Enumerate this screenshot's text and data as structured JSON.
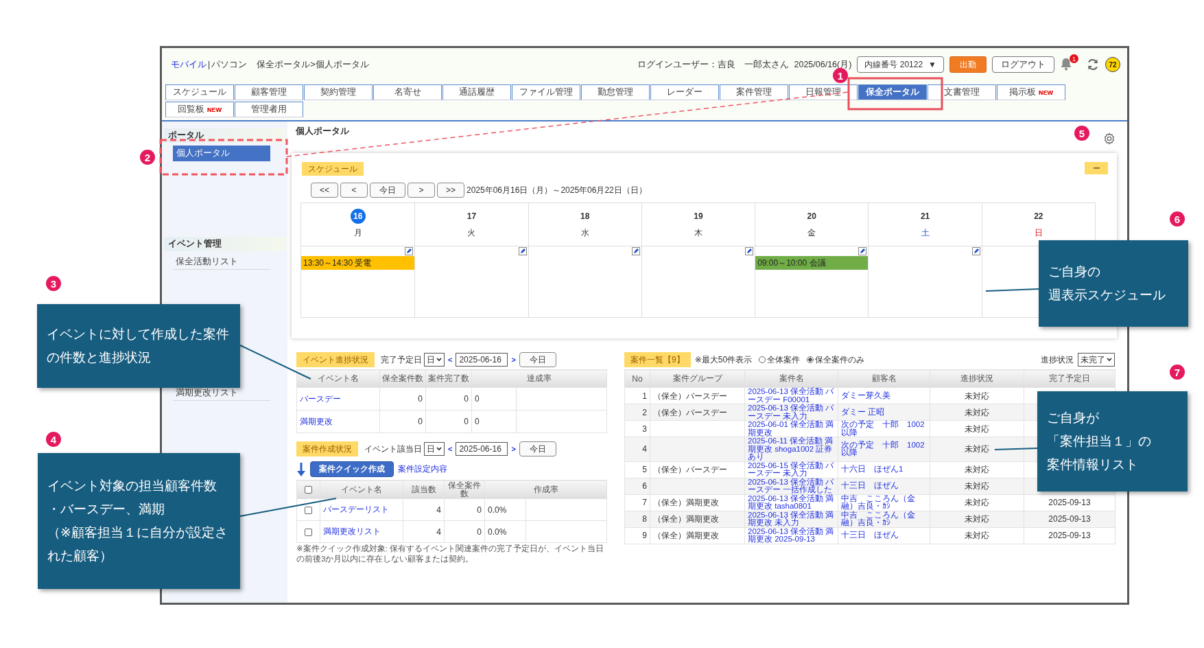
{
  "header": {
    "mobile_link": "モバイル",
    "separator": "|",
    "pc_label": "パソコン",
    "breadcrumb": "保全ポータル>個人ポータル",
    "login_user": "ログインユーザー：吉良　一郎太さん",
    "date": "2025/06/16(月)",
    "extension_select": "内線番号 20122",
    "caret": "▼",
    "clock_in_button": "出勤",
    "logout_button": "ログアウト",
    "notification_count": "1",
    "points": "72"
  },
  "tabs": [
    {
      "label": "スケジュール",
      "selected": false
    },
    {
      "label": "顧客管理",
      "selected": false
    },
    {
      "label": "契約管理",
      "selected": false
    },
    {
      "label": "名寄せ",
      "selected": false
    },
    {
      "label": "通話履歴",
      "selected": false
    },
    {
      "label": "ファイル管理",
      "selected": false
    },
    {
      "label": "勤怠管理",
      "selected": false
    },
    {
      "label": "レーダー",
      "selected": false
    },
    {
      "label": "案件管理",
      "selected": false
    },
    {
      "label": "日報管理",
      "selected": false
    },
    {
      "label": "保全ポータル",
      "selected": true
    },
    {
      "label": "文書管理",
      "selected": false
    },
    {
      "label": "掲示板",
      "selected": false,
      "badge": "NEW"
    },
    {
      "label": "回覧板",
      "selected": false,
      "badge": "NEW"
    },
    {
      "label": "管理者用",
      "selected": false
    }
  ],
  "sidebar": {
    "sections": [
      {
        "title": "ポータル",
        "items": [
          {
            "label": "個人ポータル",
            "selected": true
          }
        ]
      },
      {
        "title": "イベント管理",
        "items": [
          {
            "label": "保全活動リスト",
            "selected": false
          }
        ]
      },
      {
        "items": [
          {
            "label": "満期更改リスト",
            "selected": false
          }
        ]
      }
    ]
  },
  "page_title": "個人ポータル",
  "schedule": {
    "title": "スケジュール",
    "collapse_button": "ー",
    "nav_buttons": [
      "<<",
      "<",
      "今日",
      ">",
      ">>"
    ],
    "range": "2025年06月16日（月）～2025年06月22日（日）",
    "days": [
      {
        "date": "16",
        "weekday": "月",
        "kind": "weekday",
        "today": true,
        "events": [
          {
            "text": "13:30～14:30 受電",
            "color": "#ffc000"
          }
        ]
      },
      {
        "date": "17",
        "weekday": "火",
        "kind": "weekday",
        "today": false
      },
      {
        "date": "18",
        "weekday": "水",
        "kind": "weekday",
        "today": false
      },
      {
        "date": "19",
        "weekday": "木",
        "kind": "weekday",
        "today": false
      },
      {
        "date": "20",
        "weekday": "金",
        "kind": "weekday",
        "today": false,
        "events": [
          {
            "text": "09:00～10:00 会議",
            "color": "#70ad47"
          }
        ]
      },
      {
        "date": "21",
        "weekday": "土",
        "kind": "saturday",
        "today": false
      },
      {
        "date": "22",
        "weekday": "日",
        "kind": "sunday",
        "today": false
      }
    ]
  },
  "event_progress": {
    "title": "イベント進捗状況",
    "date_label": "完了予定日",
    "unit": "日",
    "prev": "<",
    "date": "2025-06-16",
    "next": ">",
    "today_button": "今日",
    "columns": [
      "イベント名",
      "保全案件数",
      "案件完了数",
      "達成率"
    ],
    "rows": [
      {
        "name": "バースデー",
        "cases": "0",
        "done": "0",
        "rate": "0"
      },
      {
        "name": "満期更改",
        "cases": "0",
        "done": "0",
        "rate": "0"
      }
    ]
  },
  "case_creation": {
    "title": "案件作成状況",
    "date_label": "イベント該当日",
    "unit": "日",
    "prev": "<",
    "date": "2025-06-16",
    "next": ">",
    "today_button": "今日",
    "quick_button": "案件クイック作成",
    "settings_link": "案件設定内容",
    "header_checked": false,
    "columns": [
      "イベント名",
      "該当数",
      "保全案件数",
      "作成率"
    ],
    "rows": [
      {
        "name": "バースデーリスト",
        "count": "4",
        "cases": "0",
        "rate": "0.0%",
        "checked": false
      },
      {
        "name": "満期更改リスト",
        "count": "4",
        "cases": "0",
        "rate": "0.0%",
        "checked": false
      }
    ],
    "note": "※案件クイック作成対象: 保有するイベント関連案件の完了予定日が、イベント当日の前後3か月以内に存在しない顧客または契約。"
  },
  "case_list": {
    "title": "案件一覧【9】",
    "limit_note": "※最大50件表示",
    "scope_options": [
      {
        "label": "全体案件",
        "selected": false
      },
      {
        "label": "保全案件のみ",
        "selected": true
      }
    ],
    "status_label": "進捗状況",
    "status_select": "未完了",
    "columns": [
      "No",
      "案件グループ",
      "案件名",
      "顧客名",
      "進捗状況",
      "完了予定日"
    ],
    "rows": [
      {
        "no": "1",
        "group": "（保全）バースデー",
        "name": "2025-06-13 保全活動 バースデー F00001",
        "customer": "ダミー芽久美",
        "status": "未対応"
      },
      {
        "no": "2",
        "group": "（保全）バースデー",
        "name": "2025-06-13 保全活動 バースデー 未入力",
        "customer": "ダミー 正昭",
        "status": "未対応"
      },
      {
        "no": "3",
        "name": "2025-06-01 保全活動 満期更改",
        "customer": "次の予定　十郎　1002以降",
        "status": "未対応"
      },
      {
        "no": "4",
        "name": "2025-06-11 保全活動 満期更改 shoga1002 証券あり",
        "customer": "次の予定　十郎　1002以降",
        "status": "未対応"
      },
      {
        "no": "5",
        "group": "（保全）バースデー",
        "name": "2025-06-15 保全活動 バースデー 未入力",
        "customer": "十六日　ほぜん1",
        "status": "未対応"
      },
      {
        "no": "6",
        "name": "2025-06-13 保全活動 バースデー 一括作成した",
        "customer": "十三日　ほぜん",
        "status": "未対応"
      },
      {
        "no": "7",
        "group": "（保全）満期更改",
        "name": "2025-06-13 保全活動 満期更改 tasha0801",
        "customer": "中吉　こころん（金融）吉良・ｶｼ",
        "status": "未対応",
        "due": "2025-09-13"
      },
      {
        "no": "8",
        "group": "（保全）満期更改",
        "name": "2025-06-13 保全活動 満期更改 未入力",
        "customer": "中吉　こころん（金融）吉良・ｶｼ",
        "status": "未対応",
        "due": "2025-09-13"
      },
      {
        "no": "9",
        "group": "（保全）満期更改",
        "name": "2025-06-13 保全活動 満期更改 2025-09-13",
        "customer": "十三日　ほぜん",
        "status": "未対応",
        "due": "2025-09-13"
      }
    ]
  },
  "annotations": [
    {
      "number": "1",
      "kind": "frame"
    },
    {
      "number": "2",
      "kind": "dashed_frame"
    },
    {
      "number": "3",
      "kind": "callout",
      "lines": [
        "イベントに対して作成した案件の件数と進捗状況"
      ]
    },
    {
      "number": "4",
      "kind": "callout",
      "lines": [
        "イベント対象の担当顧客件数",
        "・バースデー、満期",
        "（※顧客担当１に自分が設定された顧客）"
      ]
    },
    {
      "number": "5",
      "kind": "marker"
    },
    {
      "number": "6",
      "kind": "callout",
      "lines": [
        "ご自身の",
        "週表示スケジュール"
      ]
    },
    {
      "number": "7",
      "kind": "callout",
      "lines": [
        "ご自身が",
        "「案件担当１」の",
        "案件情報リスト"
      ]
    }
  ]
}
